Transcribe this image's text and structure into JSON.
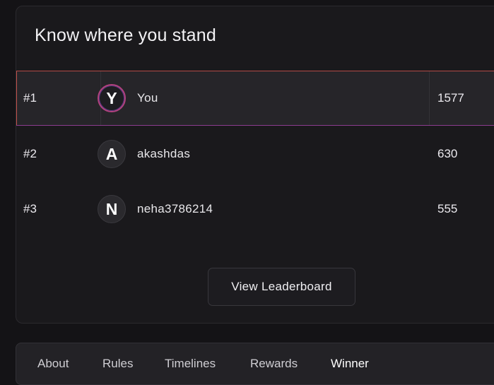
{
  "leaderboard": {
    "title": "Know where you stand",
    "rows": [
      {
        "rank": "#1",
        "initial": "Y",
        "name": "You",
        "score": "1577"
      },
      {
        "rank": "#2",
        "initial": "A",
        "name": "akashdas",
        "score": "630"
      },
      {
        "rank": "#3",
        "initial": "N",
        "name": "neha3786214",
        "score": "555"
      }
    ],
    "button_label": "View Leaderboard"
  },
  "tabs": [
    {
      "label": "About"
    },
    {
      "label": "Rules"
    },
    {
      "label": "Timelines"
    },
    {
      "label": "Rewards"
    },
    {
      "label": "Winner"
    }
  ],
  "colors": {
    "highlight_top": "#b24a45",
    "highlight_bottom": "#8c3d8f",
    "background": "#141316"
  }
}
